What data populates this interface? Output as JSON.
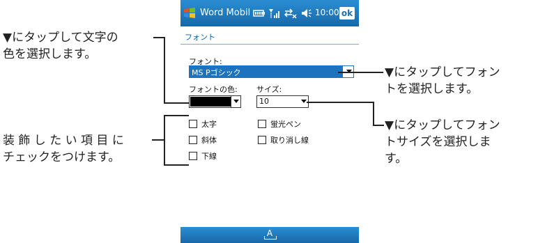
{
  "device": {
    "title_app": "Word Mobil",
    "time": "10:00",
    "ok_label": "ok",
    "page_header": "フォント",
    "font_label": "フォント:",
    "font_value": "MS Pゴシック",
    "color_label": "フォントの色:",
    "size_label": "サイズ:",
    "size_value": "10",
    "checkboxes": {
      "bold": "太字",
      "italic": "斜体",
      "underline": "下線",
      "highlight": "蛍光ペン",
      "strikethrough": "取り消し線"
    },
    "keyboard_label": "A"
  },
  "callouts": {
    "top_left_line1": "▼にタップして文字の",
    "top_left_line2": "色を選択します。",
    "mid_left_line1": "装 飾 し た い 項 目 に",
    "mid_left_line2": "チェックをつけます。",
    "top_right_line1": "▼にタップしてフォン",
    "top_right_line2": "トを選択します。",
    "mid_right_line1": "▼にタップしてフォン",
    "mid_right_line2": "トサイズを選択しま",
    "mid_right_line3": "す。"
  },
  "colors": {
    "titlebar": "#1d7cbf",
    "selection": "#1e73bf",
    "link": "#0d5ca8"
  }
}
